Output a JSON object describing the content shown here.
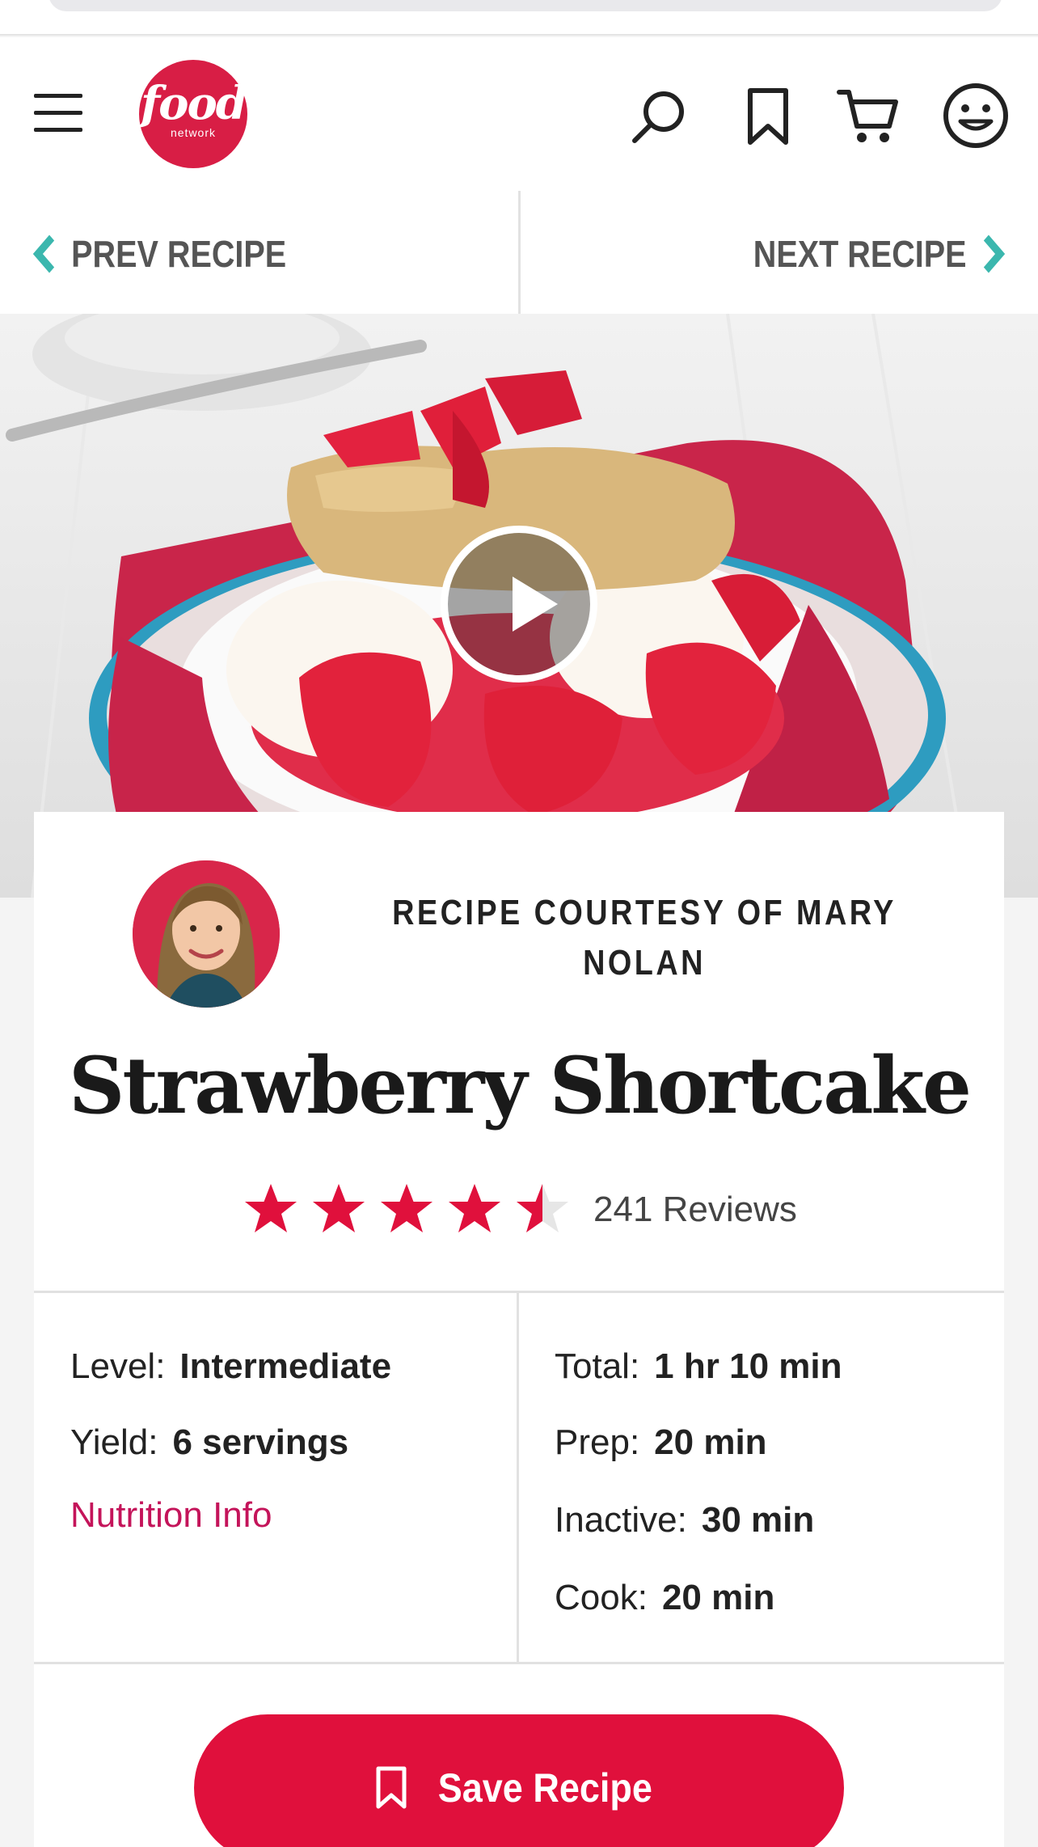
{
  "header": {
    "logo_main": "food",
    "logo_sub": "network"
  },
  "recipe_nav": {
    "prev_label": "PREV RECIPE",
    "next_label": "NEXT RECIPE"
  },
  "recipe": {
    "courtesy": "RECIPE COURTESY OF MARY NOLAN",
    "title": "Strawberry Shortcake",
    "rating": 4.5,
    "rating_max": 5,
    "reviews": "241 Reviews"
  },
  "details": {
    "level_label": "Level:",
    "level_value": "Intermediate",
    "yield_label": "Yield:",
    "yield_value": "6 servings",
    "nutrition_link": "Nutrition Info",
    "total_label": "Total:",
    "total_value": "1 hr 10 min",
    "prep_label": "Prep:",
    "prep_value": "20 min",
    "inactive_label": "Inactive:",
    "inactive_value": "30 min",
    "cook_label": "Cook:",
    "cook_value": "20 min"
  },
  "actions": {
    "save_label": "Save Recipe"
  },
  "colors": {
    "brand_red": "#e0103c",
    "logo_red": "#d81e45",
    "nav_chevron": "#3bb7ae",
    "link_magenta": "#c4145a"
  },
  "icons": [
    "hamburger-menu-icon",
    "search-icon",
    "bookmark-icon",
    "cart-icon",
    "smiley-account-icon",
    "chevron-left-icon",
    "chevron-right-icon",
    "play-icon",
    "star-icon",
    "bookmark-save-icon"
  ]
}
